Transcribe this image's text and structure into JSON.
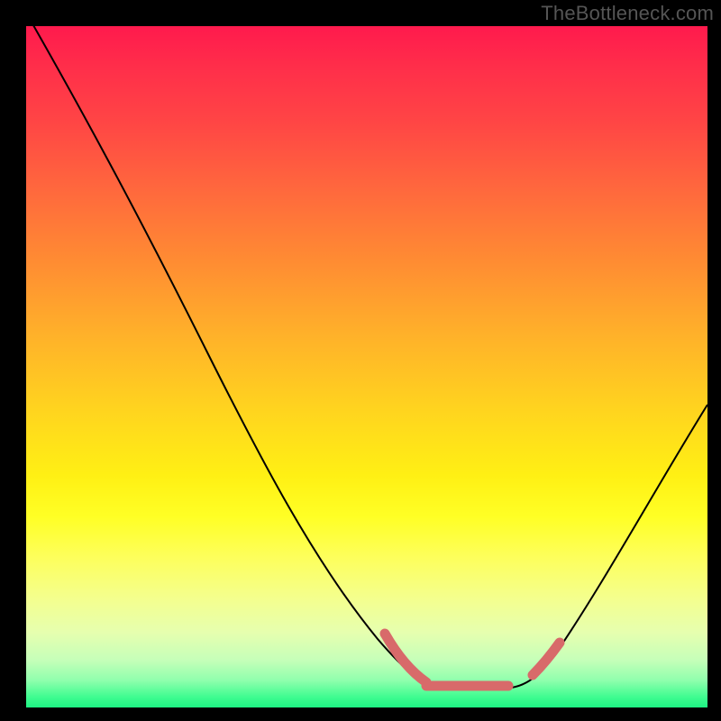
{
  "watermark": "TheBottleneck.com",
  "chart_data": {
    "type": "line",
    "title": "",
    "xlabel": "",
    "ylabel": "",
    "xlim": [
      0,
      100
    ],
    "ylim": [
      0,
      100
    ],
    "note": "Axes are percent of plot area; y=100 at top, y=0 at bottom. The plot shows a bottleneck-style curve over a vertical gradient (red→yellow→green).",
    "series": [
      {
        "name": "bottleneck-curve",
        "x": [
          0,
          4,
          10,
          18,
          26,
          34,
          42,
          50,
          55,
          58,
          62,
          66,
          70,
          74,
          77,
          82,
          88,
          94,
          100
        ],
        "y": [
          102,
          94,
          82,
          67,
          52,
          37,
          23,
          10,
          5,
          3,
          2.4,
          2.4,
          2.8,
          4,
          6,
          12,
          24,
          40,
          58
        ]
      }
    ],
    "accent_segments": [
      {
        "name": "valley-left-slope",
        "x": [
          52,
          58
        ],
        "y": [
          8,
          3
        ]
      },
      {
        "name": "valley-floor",
        "x": [
          58,
          71
        ],
        "y": [
          2.6,
          2.6
        ]
      },
      {
        "name": "valley-right-slope",
        "x": [
          74,
          78
        ],
        "y": [
          4.2,
          7
        ]
      }
    ],
    "gradient_stops": [
      {
        "pct": 0,
        "color": "#ff1a4d"
      },
      {
        "pct": 50,
        "color": "#ffd31f"
      },
      {
        "pct": 75,
        "color": "#ffff25"
      },
      {
        "pct": 100,
        "color": "#1ef283"
      }
    ]
  }
}
